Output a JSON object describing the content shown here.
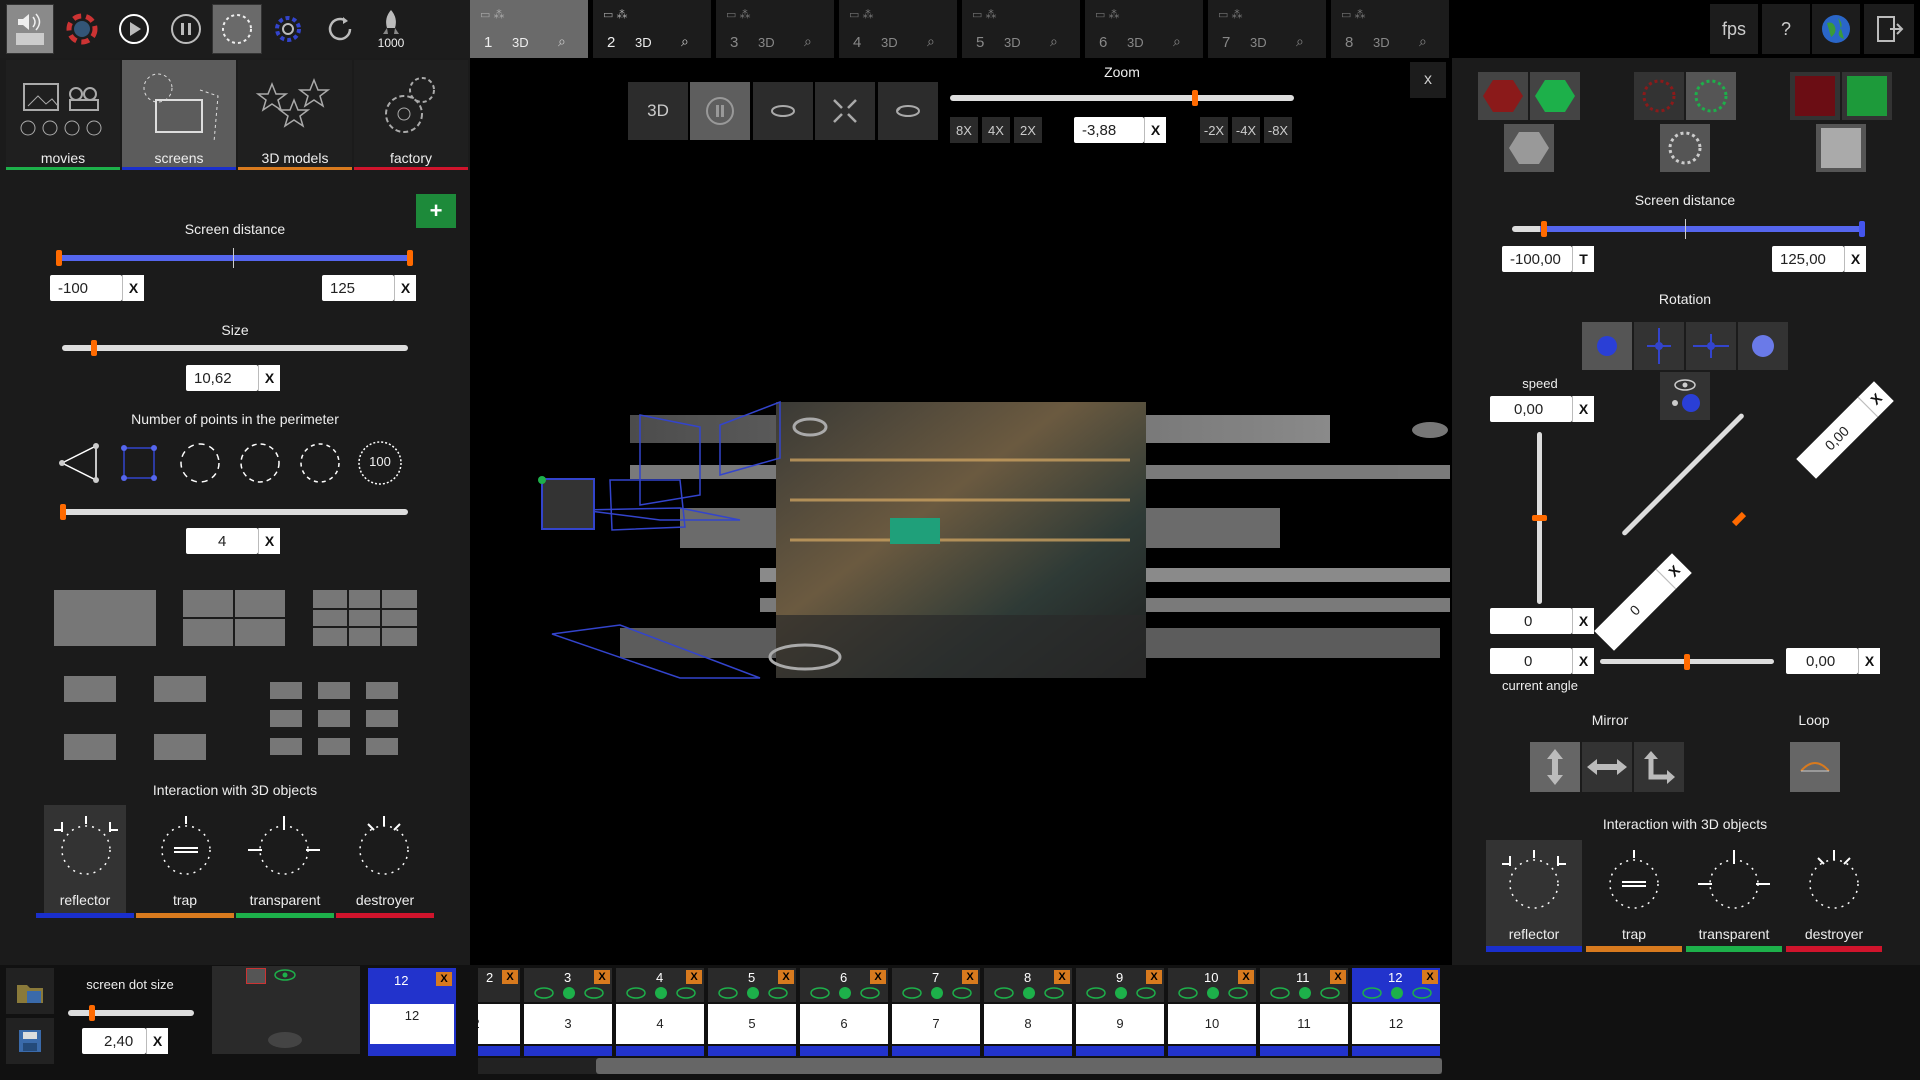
{
  "toolbar": {
    "rocket_count": "1000",
    "fps_label": "fps",
    "help_label": "?"
  },
  "camera_tabs": [
    {
      "num": "1",
      "mode": "3D"
    },
    {
      "num": "2",
      "mode": "3D"
    },
    {
      "num": "3",
      "mode": "3D"
    },
    {
      "num": "4",
      "mode": "3D"
    },
    {
      "num": "5",
      "mode": "3D"
    },
    {
      "num": "6",
      "mode": "3D"
    },
    {
      "num": "7",
      "mode": "3D"
    },
    {
      "num": "8",
      "mode": "3D"
    }
  ],
  "categories": [
    "movies",
    "screens",
    "3D models",
    "factory"
  ],
  "left_panel": {
    "screen_distance_label": "Screen distance",
    "dist_min": "-100",
    "dist_max": "125",
    "size_label": "Size",
    "size_value": "10,62",
    "perimeter_label": "Number of points in the perimeter",
    "perimeter_circle_value": "100",
    "perimeter_value": "4",
    "interaction_label": "Interaction with 3D objects",
    "interactions": [
      "reflector",
      "trap",
      "transparent",
      "destroyer"
    ],
    "x": "X",
    "plus": "+"
  },
  "viewport": {
    "btn_3d": "3D",
    "zoom_label": "Zoom",
    "zoom_value": "-3,88",
    "zoom_pos": [
      "8X",
      "4X",
      "2X"
    ],
    "zoom_neg": [
      "-2X",
      "-4X",
      "-8X"
    ],
    "close": "x"
  },
  "right_panel": {
    "screen_distance_label": "Screen distance",
    "dist_min": "-100,00",
    "dist_t": "T",
    "dist_max": "125,00",
    "rotation_label": "Rotation",
    "speed_label": "speed",
    "speed_value": "0,00",
    "vert_value": "0",
    "diag_top": "0,00",
    "diag_bottom": "0",
    "current_angle_value": "0",
    "current_angle_label": "current angle",
    "horiz_value": "0,00",
    "mirror_label": "Mirror",
    "loop_label": "Loop",
    "interaction_label": "Interaction with 3D objects",
    "interactions": [
      "reflector",
      "trap",
      "transparent",
      "destroyer"
    ]
  },
  "bottom": {
    "dot_size_label": "screen dot size",
    "dot_size_value": "2,40",
    "selected_slot": "12",
    "slots": [
      "2",
      "3",
      "4",
      "5",
      "6",
      "7",
      "8",
      "9",
      "10",
      "11",
      "12"
    ]
  },
  "colors": {
    "reflector": "#1a2fcc",
    "trap": "#d87a1e",
    "transparent": "#1db04a",
    "destroyer": "#d0142c"
  }
}
